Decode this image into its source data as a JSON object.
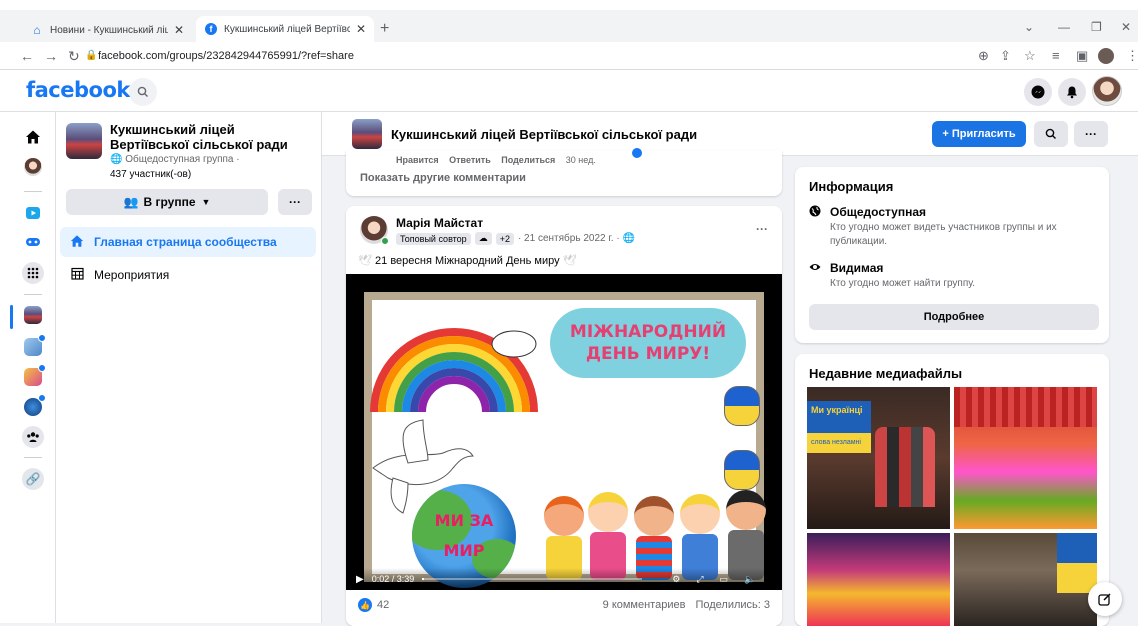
{
  "browser": {
    "tabs": [
      {
        "label": "Новини - Кукшинський ліцей Вє",
        "icon": "home-icon"
      },
      {
        "label": "Кукшинський ліцей Вертіївсько",
        "icon": "facebook-icon"
      }
    ],
    "url": "facebook.com/groups/232842944765991/?ref=share"
  },
  "fb": {
    "logo": "facebook"
  },
  "group": {
    "name": "Кукшинський ліцей Вертіївської сільської ради",
    "type": "Общедоступная группа ·",
    "members": "437 участник(-ов)",
    "ingroup_label": "В группе",
    "more_label": "···",
    "nav": [
      {
        "label": "Главная страница сообщества"
      },
      {
        "label": "Мероприятия"
      }
    ]
  },
  "main_header": {
    "title": "Кукшинський ліцей Вертіївської сільської ради",
    "invite_label": "+ Пригласить",
    "more_label": "···"
  },
  "comments": {
    "actions": [
      "Нравится",
      "Ответить",
      "Поделиться",
      "30 нед."
    ],
    "show_more": "Показать другие комментарии"
  },
  "post": {
    "author": "Марія Майстат",
    "badge": "Топовый совтор",
    "extra": "+2",
    "date": "· 21 сентябрь 2022 г. ·",
    "text": "21 вересня Міжнародний День миру",
    "banner_text": "МІЖНАРОДНИЙ ДЕНЬ МИРУ!",
    "globe_text": "МИ ЗА МИР",
    "video_time": "0:02 / 3:39",
    "likes": "42",
    "comments": "9 комментариев",
    "shares": "Поделились: 3"
  },
  "info": {
    "title": "Информация",
    "items": [
      {
        "icon": "globe-icon",
        "head": "Общедоступная",
        "desc": "Кто угодно может видеть участников группы и их публикации."
      },
      {
        "icon": "eye-icon",
        "head": "Видимая",
        "desc": "Кто угодно может найти группу."
      }
    ],
    "more_label": "Подробнее"
  },
  "media": {
    "title": "Недавние медиафайлы",
    "tile_text": "Ми українці",
    "tile_sub": "слова незламні"
  }
}
